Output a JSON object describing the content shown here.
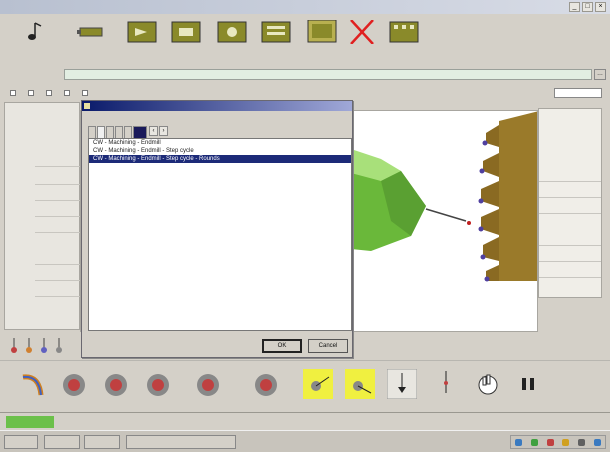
{
  "colors": {
    "toolbar_icon_olive": "#8a8a2a",
    "delete_red": "#e02020",
    "path_field_bg": "#e2eee2",
    "dialog_title_dark": "#0a1a6a",
    "selection_blue": "#1c2a78",
    "wheel_green": "#7ed04a",
    "cutter_brown": "#9a7a2a",
    "highlight_yellow": "#f0f040",
    "status_green": "#6cc04a"
  },
  "dialog": {
    "items": [
      {
        "text": "CW - Machining - Endmill"
      },
      {
        "text": "CW - Machining - Endmill - Step cycle"
      },
      {
        "text": "CW - Machining - Endmill - Step cycle - Rounds"
      }
    ],
    "ok_label": "OK",
    "cancel_label": "Cancel"
  }
}
